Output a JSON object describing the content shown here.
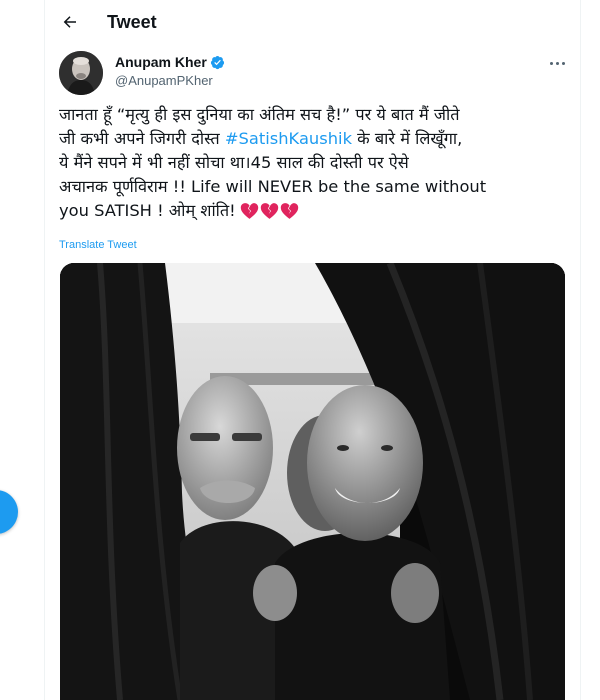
{
  "header": {
    "title": "Tweet",
    "back_icon": "arrow-left-icon"
  },
  "author": {
    "name": "Anupam Kher",
    "handle": "@AnupamPKher",
    "verified": true,
    "verified_icon": "verified-badge-icon",
    "more_icon": "more-horizontal-icon"
  },
  "tweet": {
    "line1": "जानता हूँ “मृत्यु ही इस दुनिया का अंतिम सच है!” पर ये बात मैं जीते",
    "line2_before": "जी कभी अपने जिगरी दोस्त ",
    "hashtag": "#SatishKaushik",
    "line2_after": " के बारे में लिखूँगा,",
    "line3": "ये मैंने सपने में भी नहीं सोचा था।45 साल की दोस्ती पर ऐसे",
    "line4": "अचानक पूर्णविराम !! Life will NEVER be the same without",
    "line5": "you SATISH ! ओम् शांति!",
    "emoji": "broken-heart-icon ×3",
    "translate_label": "Translate Tweet"
  },
  "media": {
    "type": "photo",
    "description_icon": "tweet-photo"
  },
  "colors": {
    "accent": "#1d9bf0",
    "text": "#0f1419",
    "secondary": "#536471",
    "broken_heart": "#e0245e"
  }
}
